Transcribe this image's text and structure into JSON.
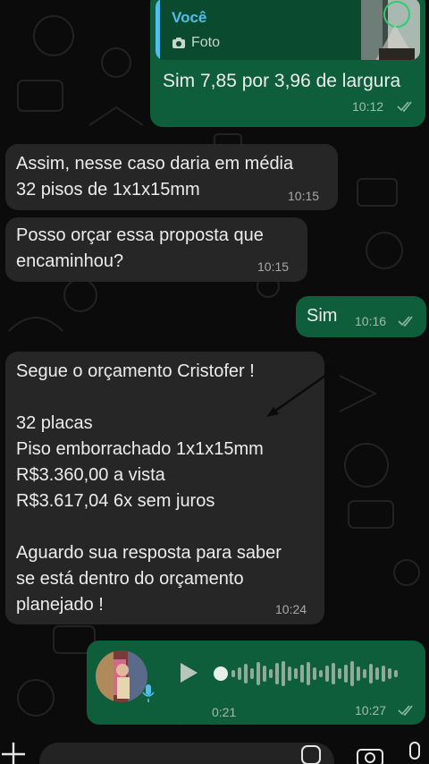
{
  "chat": {
    "reply_bubble": {
      "quote_author": "Você",
      "quote_type": "Foto",
      "text": "Sim 7,85 por 3,96 de largura",
      "time": "10:12"
    },
    "msg1": {
      "text": "Assim, nesse caso daria em média\n32 pisos de 1x1x15mm",
      "time": "10:15"
    },
    "msg2": {
      "text": "Posso orçar essa proposta que\nencaminhou?",
      "time": "10:15"
    },
    "msg3": {
      "text": "Sim",
      "time": "10:16"
    },
    "msg4": {
      "text": "Segue o orçamento Cristofer !\n\n32 placas\nPiso emborrachado 1x1x15mm\nR$3.360,00 a vista\nR$3.617,04 6x sem juros\n\nAguardo sua resposta para saber\nse está dentro do orçamento\nplanejado !",
      "time": "10:24"
    },
    "voice": {
      "duration": "0:21",
      "time": "10:27",
      "progress": 0
    }
  },
  "colors": {
    "incoming": "#262626",
    "outgoing": "#0f5e3b",
    "quote_accent": "#53bdeb",
    "read_ticks": "#8fb8a6"
  },
  "icons": [
    "camera-icon",
    "double-check-icon",
    "play-icon",
    "mic-icon",
    "plus-icon",
    "sticker-icon"
  ]
}
